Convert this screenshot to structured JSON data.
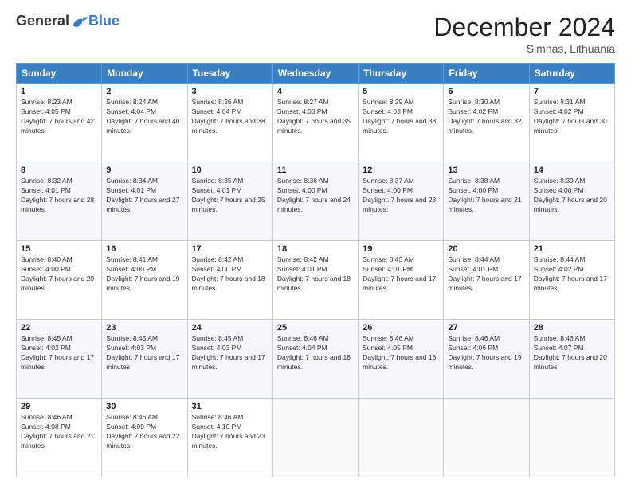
{
  "logo": {
    "general": "General",
    "blue": "Blue"
  },
  "title": "December 2024",
  "location": "Simnas, Lithuania",
  "days_of_week": [
    "Sunday",
    "Monday",
    "Tuesday",
    "Wednesday",
    "Thursday",
    "Friday",
    "Saturday"
  ],
  "weeks": [
    [
      {
        "day": "1",
        "sunrise": "8:23 AM",
        "sunset": "4:05 PM",
        "daylight": "7 hours and 42 minutes."
      },
      {
        "day": "2",
        "sunrise": "8:24 AM",
        "sunset": "4:04 PM",
        "daylight": "7 hours and 40 minutes."
      },
      {
        "day": "3",
        "sunrise": "8:26 AM",
        "sunset": "4:04 PM",
        "daylight": "7 hours and 38 minutes."
      },
      {
        "day": "4",
        "sunrise": "8:27 AM",
        "sunset": "4:03 PM",
        "daylight": "7 hours and 35 minutes."
      },
      {
        "day": "5",
        "sunrise": "8:29 AM",
        "sunset": "4:03 PM",
        "daylight": "7 hours and 33 minutes."
      },
      {
        "day": "6",
        "sunrise": "8:30 AM",
        "sunset": "4:02 PM",
        "daylight": "7 hours and 32 minutes."
      },
      {
        "day": "7",
        "sunrise": "8:31 AM",
        "sunset": "4:02 PM",
        "daylight": "7 hours and 30 minutes."
      }
    ],
    [
      {
        "day": "8",
        "sunrise": "8:32 AM",
        "sunset": "4:01 PM",
        "daylight": "7 hours and 28 minutes."
      },
      {
        "day": "9",
        "sunrise": "8:34 AM",
        "sunset": "4:01 PM",
        "daylight": "7 hours and 27 minutes."
      },
      {
        "day": "10",
        "sunrise": "8:35 AM",
        "sunset": "4:01 PM",
        "daylight": "7 hours and 25 minutes."
      },
      {
        "day": "11",
        "sunrise": "8:36 AM",
        "sunset": "4:00 PM",
        "daylight": "7 hours and 24 minutes."
      },
      {
        "day": "12",
        "sunrise": "8:37 AM",
        "sunset": "4:00 PM",
        "daylight": "7 hours and 23 minutes."
      },
      {
        "day": "13",
        "sunrise": "8:38 AM",
        "sunset": "4:00 PM",
        "daylight": "7 hours and 21 minutes."
      },
      {
        "day": "14",
        "sunrise": "8:39 AM",
        "sunset": "4:00 PM",
        "daylight": "7 hours and 20 minutes."
      }
    ],
    [
      {
        "day": "15",
        "sunrise": "8:40 AM",
        "sunset": "4:00 PM",
        "daylight": "7 hours and 20 minutes."
      },
      {
        "day": "16",
        "sunrise": "8:41 AM",
        "sunset": "4:00 PM",
        "daylight": "7 hours and 19 minutes."
      },
      {
        "day": "17",
        "sunrise": "8:42 AM",
        "sunset": "4:00 PM",
        "daylight": "7 hours and 18 minutes."
      },
      {
        "day": "18",
        "sunrise": "8:42 AM",
        "sunset": "4:01 PM",
        "daylight": "7 hours and 18 minutes."
      },
      {
        "day": "19",
        "sunrise": "8:43 AM",
        "sunset": "4:01 PM",
        "daylight": "7 hours and 17 minutes."
      },
      {
        "day": "20",
        "sunrise": "8:44 AM",
        "sunset": "4:01 PM",
        "daylight": "7 hours and 17 minutes."
      },
      {
        "day": "21",
        "sunrise": "8:44 AM",
        "sunset": "4:02 PM",
        "daylight": "7 hours and 17 minutes."
      }
    ],
    [
      {
        "day": "22",
        "sunrise": "8:45 AM",
        "sunset": "4:02 PM",
        "daylight": "7 hours and 17 minutes."
      },
      {
        "day": "23",
        "sunrise": "8:45 AM",
        "sunset": "4:03 PM",
        "daylight": "7 hours and 17 minutes."
      },
      {
        "day": "24",
        "sunrise": "8:45 AM",
        "sunset": "4:03 PM",
        "daylight": "7 hours and 17 minutes."
      },
      {
        "day": "25",
        "sunrise": "8:46 AM",
        "sunset": "4:04 PM",
        "daylight": "7 hours and 18 minutes."
      },
      {
        "day": "26",
        "sunrise": "8:46 AM",
        "sunset": "4:05 PM",
        "daylight": "7 hours and 18 minutes."
      },
      {
        "day": "27",
        "sunrise": "8:46 AM",
        "sunset": "4:06 PM",
        "daylight": "7 hours and 19 minutes."
      },
      {
        "day": "28",
        "sunrise": "8:46 AM",
        "sunset": "4:07 PM",
        "daylight": "7 hours and 20 minutes."
      }
    ],
    [
      {
        "day": "29",
        "sunrise": "8:46 AM",
        "sunset": "4:08 PM",
        "daylight": "7 hours and 21 minutes."
      },
      {
        "day": "30",
        "sunrise": "8:46 AM",
        "sunset": "4:09 PM",
        "daylight": "7 hours and 22 minutes."
      },
      {
        "day": "31",
        "sunrise": "8:46 AM",
        "sunset": "4:10 PM",
        "daylight": "7 hours and 23 minutes."
      },
      null,
      null,
      null,
      null
    ]
  ]
}
